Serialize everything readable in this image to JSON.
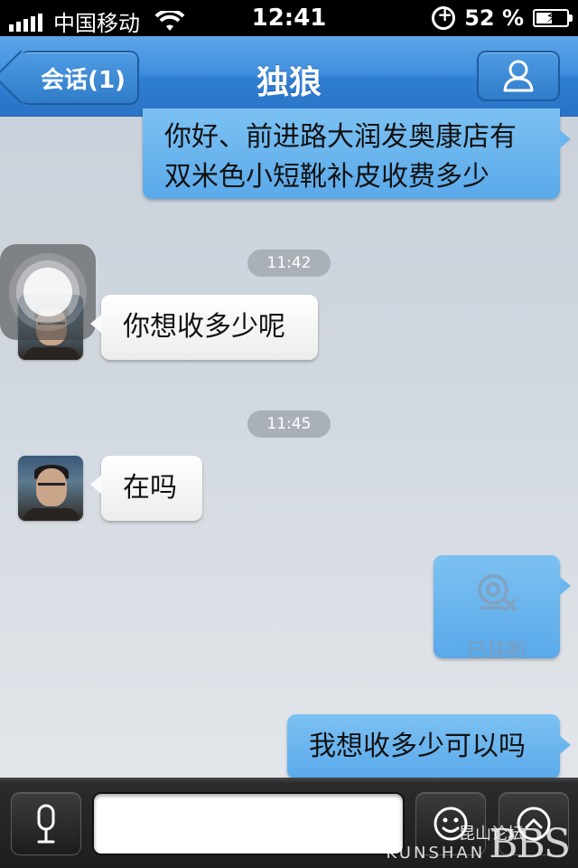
{
  "status_bar": {
    "carrier": "中国移动",
    "time": "12:41",
    "battery_percent": "52 %",
    "battery_level": 0.52
  },
  "nav": {
    "back_label": "会话(1)",
    "title": "独狼"
  },
  "messages": [
    {
      "side": "right",
      "text_line1": "你好、前进路大润发奥康店有",
      "text_line2": "双米色小短靴补皮收费多少"
    },
    {
      "timestamp": "11:42"
    },
    {
      "side": "left",
      "text": "你想收多少呢"
    },
    {
      "timestamp": "11:45"
    },
    {
      "side": "left",
      "text": "在吗"
    },
    {
      "side": "right",
      "type": "call",
      "call_label": "已挂断"
    },
    {
      "side": "right",
      "text": "我想收多少可以吗"
    }
  ],
  "input": {
    "value": ""
  },
  "watermark": {
    "cn": "昆山论坛",
    "latin": "KUNSHAN",
    "big": "BBS"
  },
  "icons": {
    "voice": "microphone-icon",
    "emoji": "smiley-icon",
    "more": "chevron-up-icon",
    "profile": "person-icon",
    "call": "webcam-hangup-icon"
  },
  "colors": {
    "nav_blue": "#3f8ede",
    "bubble_blue": "#6cb6ee",
    "bubble_white": "#ffffff",
    "timestamp_bg": "#a9b0b8"
  }
}
